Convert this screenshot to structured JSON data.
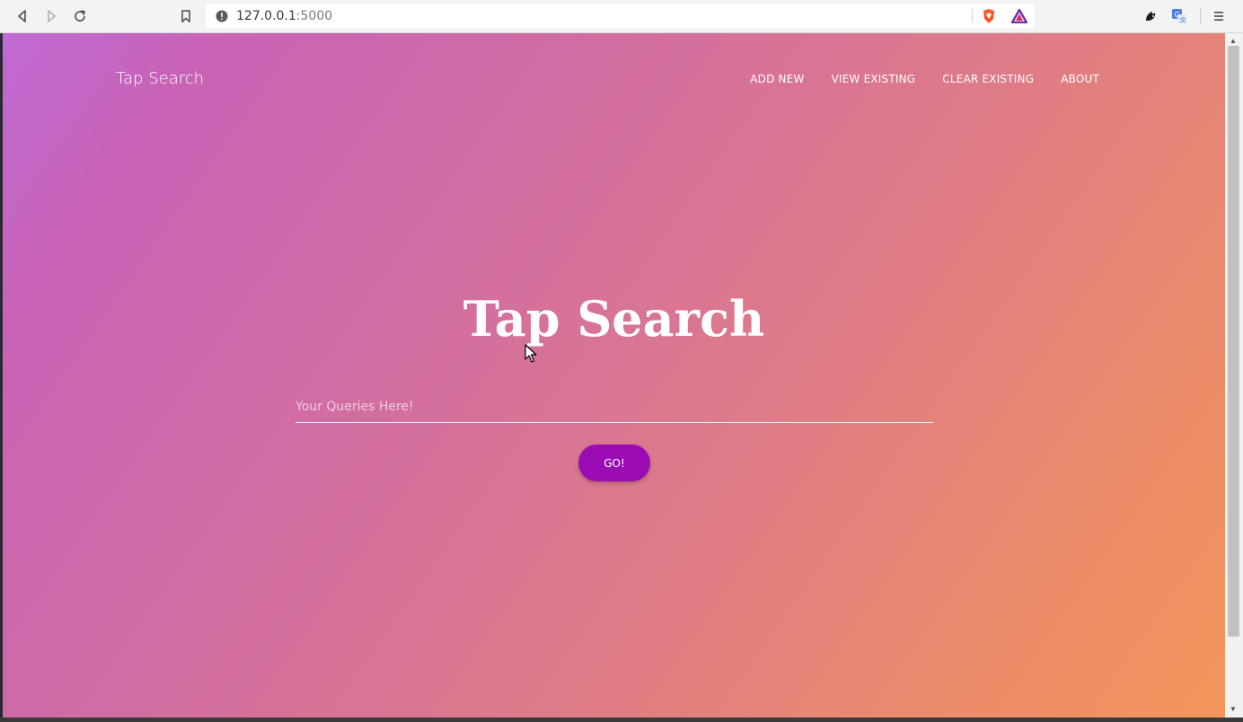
{
  "browser": {
    "url_host": "127.0.0.1",
    "url_port": ":5000",
    "icons": [
      "back-icon",
      "forward-icon",
      "reload-icon",
      "bookmark-icon",
      "info-icon",
      "brave-shield-icon",
      "brave-rewards-icon",
      "extension-icon",
      "translate-icon",
      "menu-icon"
    ]
  },
  "nav": {
    "brand": "Tap Search",
    "links": [
      "ADD NEW",
      "VIEW EXISTING",
      "CLEAR EXISTING",
      "ABOUT"
    ]
  },
  "hero": {
    "title": "Tap Search"
  },
  "search": {
    "placeholder": "Your Queries Here!",
    "value": ""
  },
  "button": {
    "go_label": "GO!"
  },
  "colors": {
    "button": "#9a0bb4",
    "gradient_start": "#c06ad4",
    "gradient_end": "#f4955b"
  }
}
